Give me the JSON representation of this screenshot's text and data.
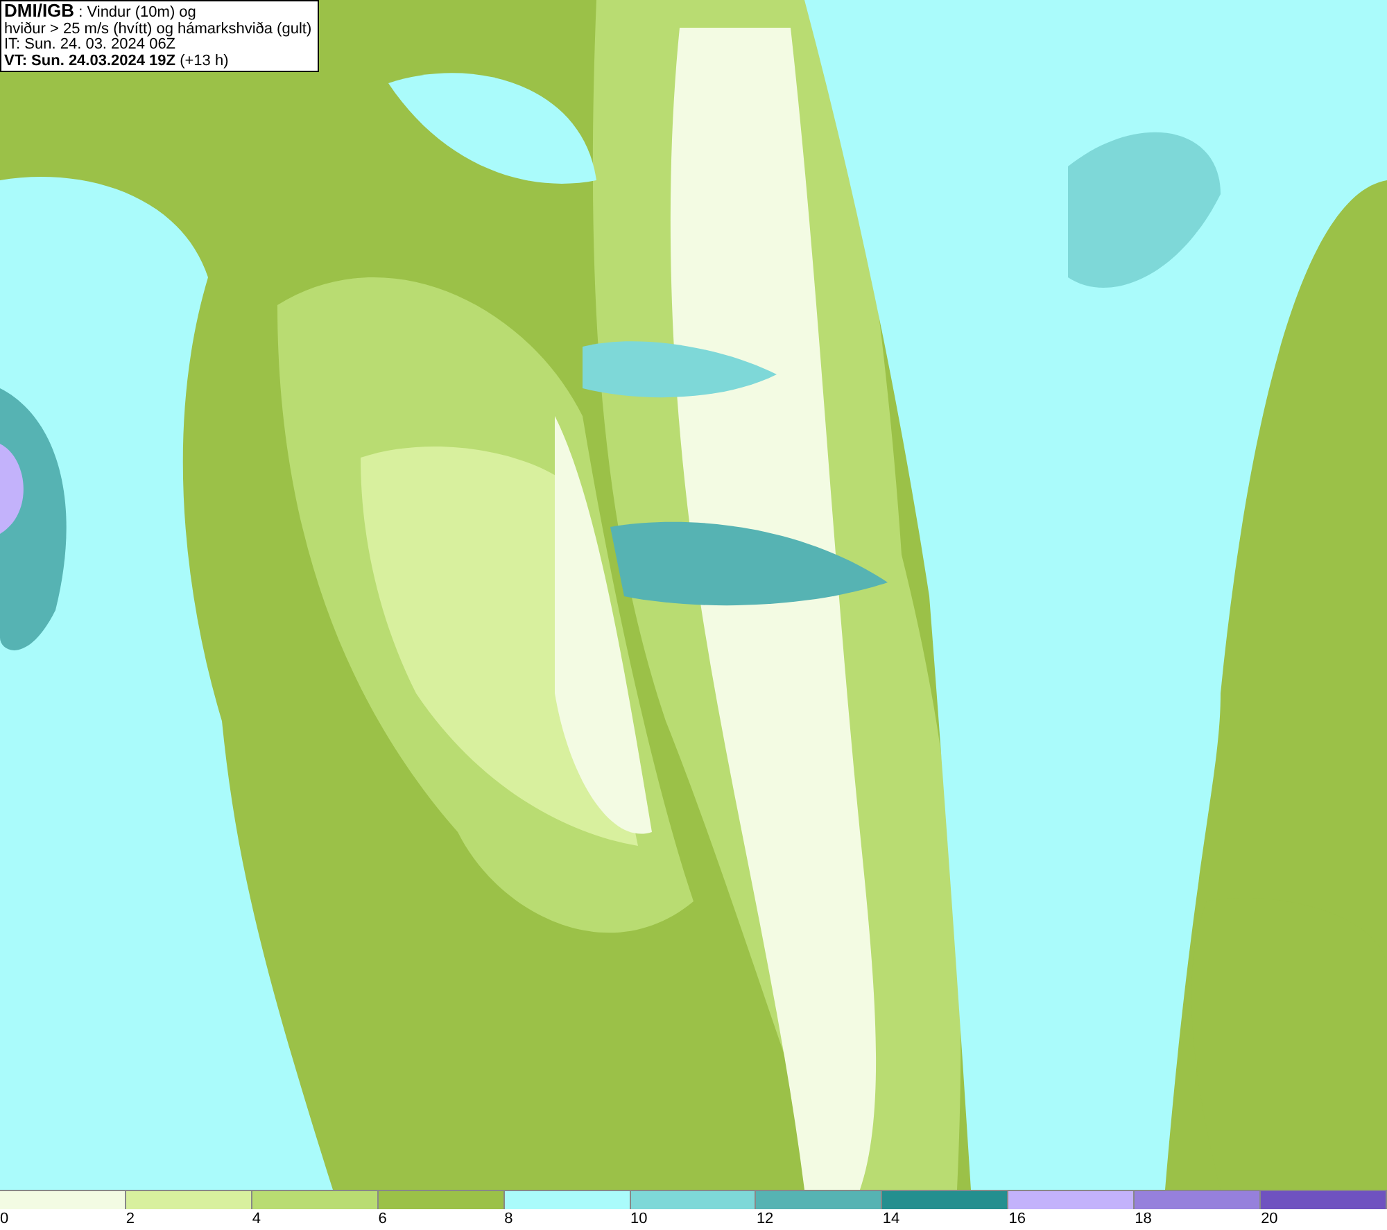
{
  "title_box": {
    "lines": [
      "**DMI/IGB** : Vindur (10m) og",
      "hviður > 25 m/s (hvítt) og hámarkshviða (gult)",
      "IT: Sun. 24. 03. 2024 06Z",
      "**VT: Sun. 24.03.2024 19Z** (+13 h)"
    ]
  },
  "legend": [
    {
      "label": "0",
      "color": "#f3fbe3"
    },
    {
      "label": "2",
      "color": "#d8f09e"
    },
    {
      "label": "4",
      "color": "#b9dc72"
    },
    {
      "label": "6",
      "color": "#9bc148"
    },
    {
      "label": "8",
      "color": "#aafbfb"
    },
    {
      "label": "10",
      "color": "#7ed8d8"
    },
    {
      "label": "12",
      "color": "#56b3b3"
    },
    {
      "label": "14",
      "color": "#248f8f"
    },
    {
      "label": "16",
      "color": "#c3b2fb"
    },
    {
      "label": "18",
      "color": "#9680dc"
    },
    {
      "label": "20",
      "color": "#6f52c0"
    }
  ]
}
